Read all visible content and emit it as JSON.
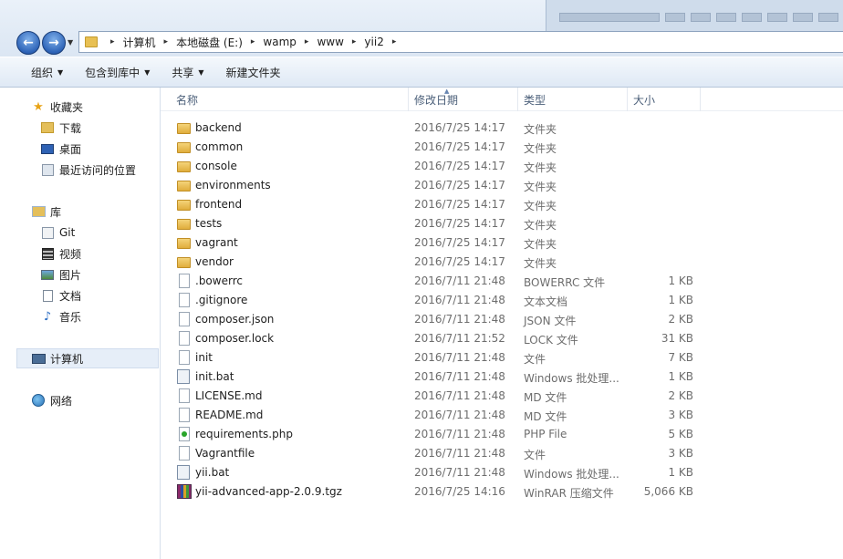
{
  "address": {
    "crumbs": [
      "计算机",
      "本地磁盘 (E:)",
      "wamp",
      "www",
      "yii2"
    ]
  },
  "toolbar": {
    "organize": "组织",
    "include_library": "包含到库中",
    "share": "共享",
    "new_folder": "新建文件夹"
  },
  "sidebar": {
    "favorites": "收藏夹",
    "downloads": "下载",
    "desktop": "桌面",
    "recent": "最近访问的位置",
    "libraries": "库",
    "git": "Git",
    "video": "视频",
    "pictures": "图片",
    "documents": "文档",
    "music": "音乐",
    "computer": "计算机",
    "network": "网络"
  },
  "columns": {
    "name": "名称",
    "date": "修改日期",
    "type": "类型",
    "size": "大小"
  },
  "files": [
    {
      "name": "backend",
      "date": "2016/7/25 14:17",
      "type": "文件夹",
      "size": "",
      "icon": "folder-icon"
    },
    {
      "name": "common",
      "date": "2016/7/25 14:17",
      "type": "文件夹",
      "size": "",
      "icon": "folder-icon"
    },
    {
      "name": "console",
      "date": "2016/7/25 14:17",
      "type": "文件夹",
      "size": "",
      "icon": "folder-icon"
    },
    {
      "name": "environments",
      "date": "2016/7/25 14:17",
      "type": "文件夹",
      "size": "",
      "icon": "folder-icon"
    },
    {
      "name": "frontend",
      "date": "2016/7/25 14:17",
      "type": "文件夹",
      "size": "",
      "icon": "folder-icon"
    },
    {
      "name": "tests",
      "date": "2016/7/25 14:17",
      "type": "文件夹",
      "size": "",
      "icon": "folder-icon"
    },
    {
      "name": "vagrant",
      "date": "2016/7/25 14:17",
      "type": "文件夹",
      "size": "",
      "icon": "folder-icon"
    },
    {
      "name": "vendor",
      "date": "2016/7/25 14:17",
      "type": "文件夹",
      "size": "",
      "icon": "folder-icon"
    },
    {
      "name": ".bowerrc",
      "date": "2016/7/11 21:48",
      "type": "BOWERRC 文件",
      "size": "1 KB",
      "icon": "file-icon"
    },
    {
      "name": ".gitignore",
      "date": "2016/7/11 21:48",
      "type": "文本文档",
      "size": "1 KB",
      "icon": "file-icon"
    },
    {
      "name": "composer.json",
      "date": "2016/7/11 21:48",
      "type": "JSON 文件",
      "size": "2 KB",
      "icon": "file-icon"
    },
    {
      "name": "composer.lock",
      "date": "2016/7/11 21:52",
      "type": "LOCK 文件",
      "size": "31 KB",
      "icon": "file-icon"
    },
    {
      "name": "init",
      "date": "2016/7/11 21:48",
      "type": "文件",
      "size": "7 KB",
      "icon": "file-icon"
    },
    {
      "name": "init.bat",
      "date": "2016/7/11 21:48",
      "type": "Windows 批处理...",
      "size": "1 KB",
      "icon": "batch-file-icon"
    },
    {
      "name": "LICENSE.md",
      "date": "2016/7/11 21:48",
      "type": "MD 文件",
      "size": "2 KB",
      "icon": "file-icon"
    },
    {
      "name": "README.md",
      "date": "2016/7/11 21:48",
      "type": "MD 文件",
      "size": "3 KB",
      "icon": "file-icon"
    },
    {
      "name": "requirements.php",
      "date": "2016/7/11 21:48",
      "type": "PHP File",
      "size": "5 KB",
      "icon": "php-file-icon"
    },
    {
      "name": "Vagrantfile",
      "date": "2016/7/11 21:48",
      "type": "文件",
      "size": "3 KB",
      "icon": "file-icon"
    },
    {
      "name": "yii.bat",
      "date": "2016/7/11 21:48",
      "type": "Windows 批处理...",
      "size": "1 KB",
      "icon": "batch-file-icon"
    },
    {
      "name": "yii-advanced-app-2.0.9.tgz",
      "date": "2016/7/25 14:16",
      "type": "WinRAR 压缩文件",
      "size": "5,066 KB",
      "icon": "winrar-archive-icon"
    }
  ]
}
